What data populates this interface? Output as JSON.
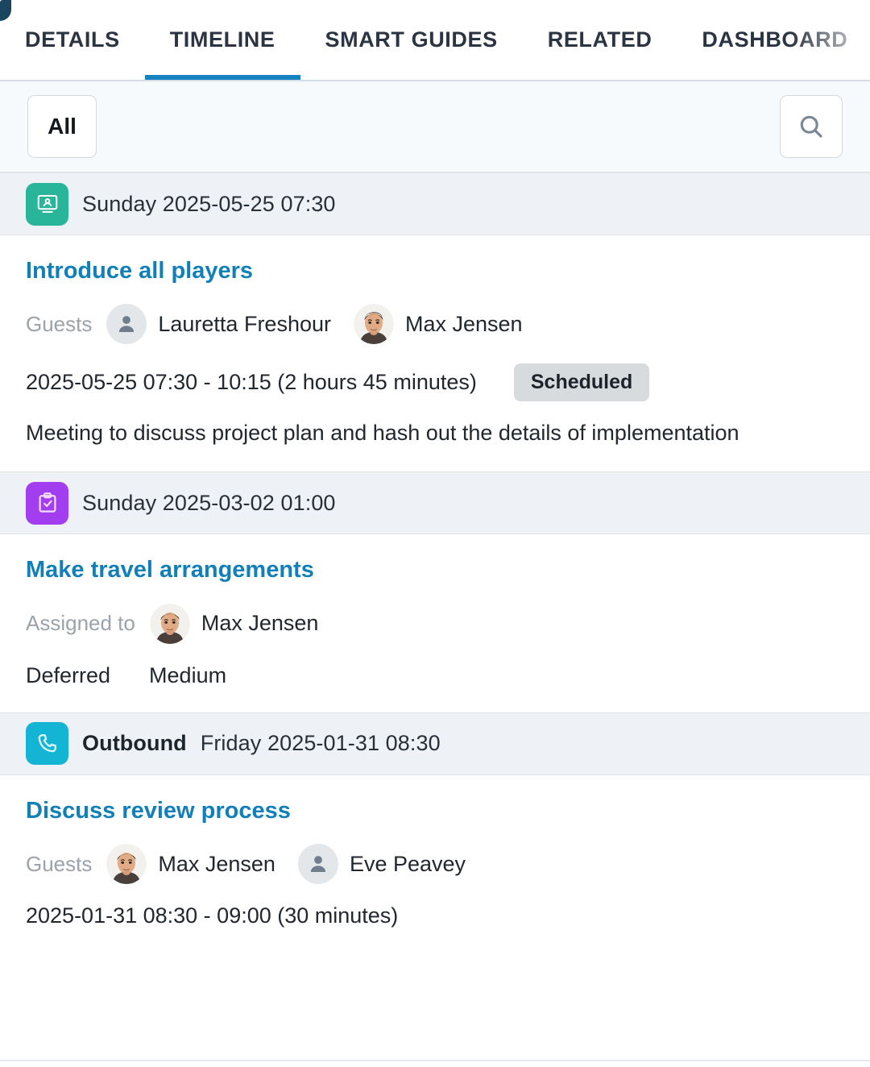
{
  "tabs": [
    {
      "label": "DETAILS",
      "active": false,
      "faded": false
    },
    {
      "label": "TIMELINE",
      "active": true,
      "faded": false
    },
    {
      "label": "SMART GUIDES",
      "active": false,
      "faded": false
    },
    {
      "label": "RELATED",
      "active": false,
      "faded": false
    },
    {
      "label": "DASHBOARD",
      "active": false,
      "faded": true
    }
  ],
  "filterbar": {
    "filter_label": "All",
    "search_icon": "search-icon"
  },
  "colors": {
    "accent_blue": "#1583c0",
    "link_blue": "#1280b8",
    "meeting_icon_bg": "#29b59a",
    "task_icon_bg": "#a33ef0",
    "call_icon_bg": "#14b4d4",
    "section_bg": "#eef1f5",
    "badge_bg": "#d8dbde"
  },
  "timeline": [
    {
      "icon": "presentation-icon",
      "icon_color": "#29b59a",
      "direction": "",
      "date": "Sunday 2025-05-25 07:30",
      "title": "Introduce all players",
      "people_label": "Guests",
      "people": [
        {
          "name": "Lauretta Freshour",
          "avatar": "placeholder"
        },
        {
          "name": "Max Jensen",
          "avatar": "photo"
        }
      ],
      "time_range": "2025-05-25 07:30 - 10:15 (2 hours 45 minutes)",
      "badge": "Scheduled",
      "description": "Meeting to discuss project plan and hash out the details of implementation"
    },
    {
      "icon": "clipboard-check-icon",
      "icon_color": "#a33ef0",
      "direction": "",
      "date": "Sunday 2025-03-02 01:00",
      "title": "Make travel arrangements",
      "people_label": "Assigned to",
      "people": [
        {
          "name": "Max Jensen",
          "avatar": "photo"
        }
      ],
      "status": "Deferred",
      "priority": "Medium"
    },
    {
      "icon": "phone-icon",
      "icon_color": "#14b4d4",
      "direction": "Outbound",
      "date": "Friday 2025-01-31 08:30",
      "title": "Discuss review process",
      "people_label": "Guests",
      "people": [
        {
          "name": "Max Jensen",
          "avatar": "photo"
        },
        {
          "name": "Eve Peavey",
          "avatar": "placeholder"
        }
      ],
      "time_range": "2025-01-31 08:30 - 09:00 (30 minutes)"
    }
  ]
}
